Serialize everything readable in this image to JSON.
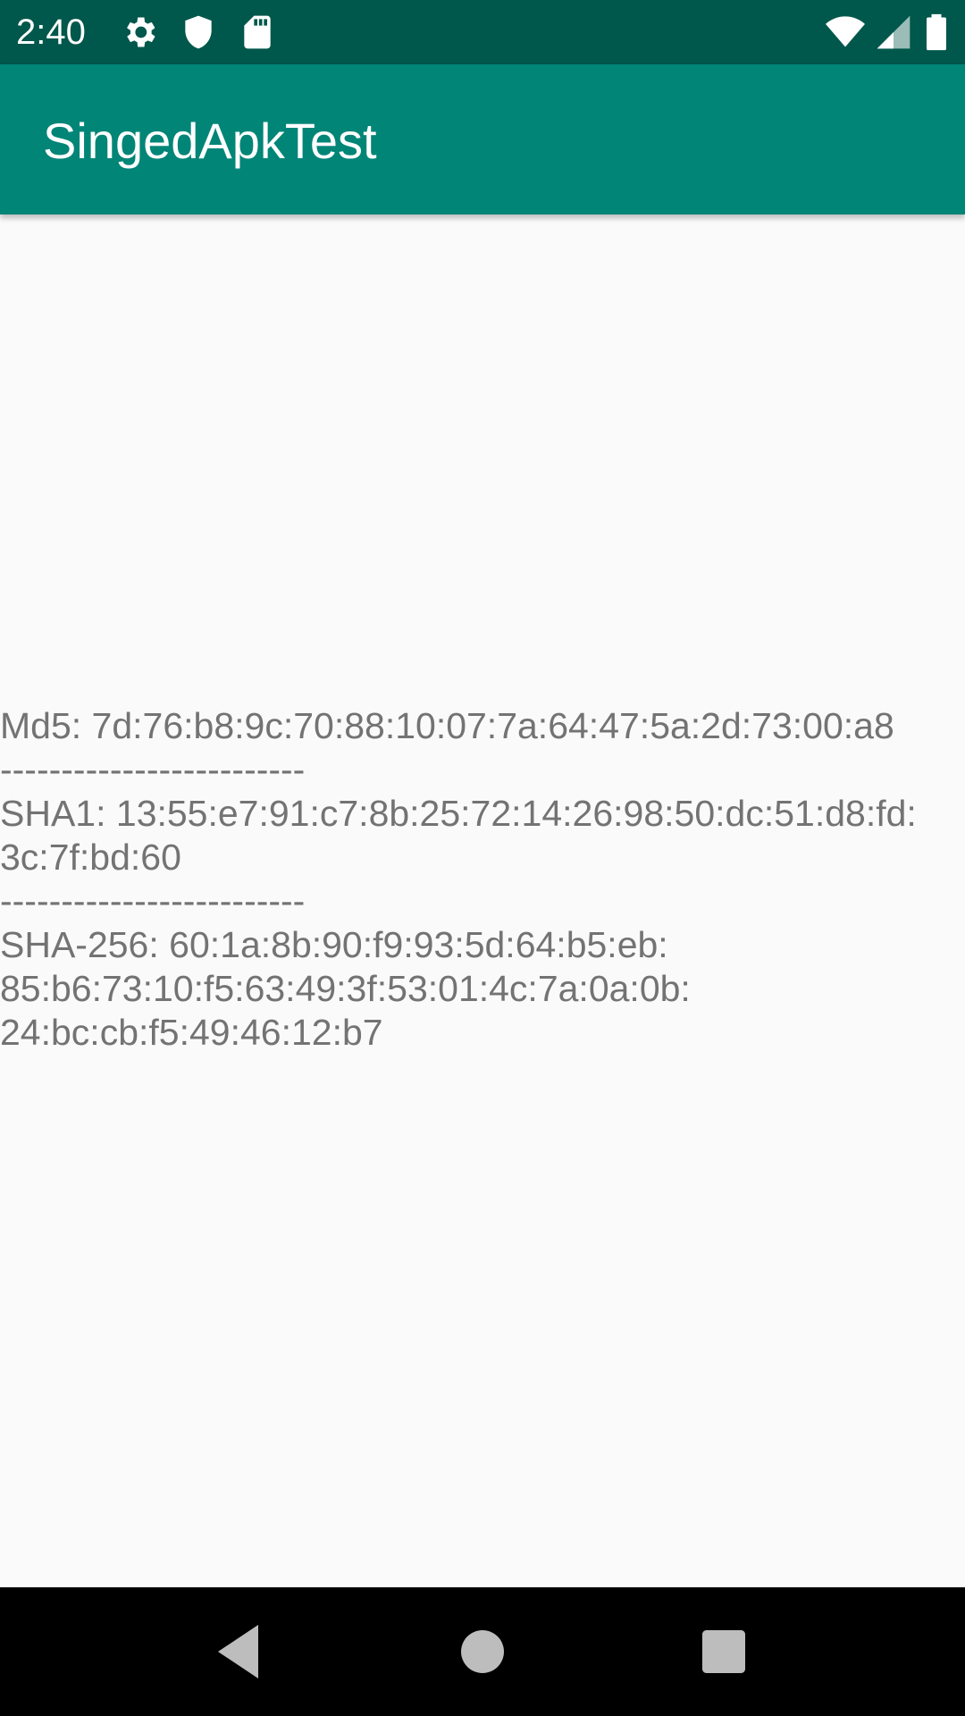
{
  "status_bar": {
    "time": "2:40",
    "icons": [
      "gear-icon",
      "shield-icon",
      "sd-card-icon",
      "wifi-icon",
      "signal-icon",
      "battery-icon"
    ],
    "background_color": "#00574b"
  },
  "app_bar": {
    "title": "SingedApkTest",
    "background_color": "#008577"
  },
  "content": {
    "lines": [
      "Md5: 7d:76:b8:9c:70:88:10:07:7a:64:47:5a:2d:73:00:a8",
      "-------------------------",
      "SHA1: 13:55:e7:91:c7:8b:25:72:14:26:98:50:dc:51:d8:fd:",
      "3c:7f:bd:60",
      "-------------------------",
      "SHA-256: 60:1a:8b:90:f9:93:5d:64:b5:eb:",
      "85:b6:73:10:f5:63:49:3f:53:01:4c:7a:0a:0b:",
      "24:bc:cb:f5:49:46:12:b7"
    ],
    "text_color": "#737373"
  },
  "nav_bar": {
    "buttons": [
      "back-icon",
      "home-icon",
      "recents-icon"
    ]
  }
}
